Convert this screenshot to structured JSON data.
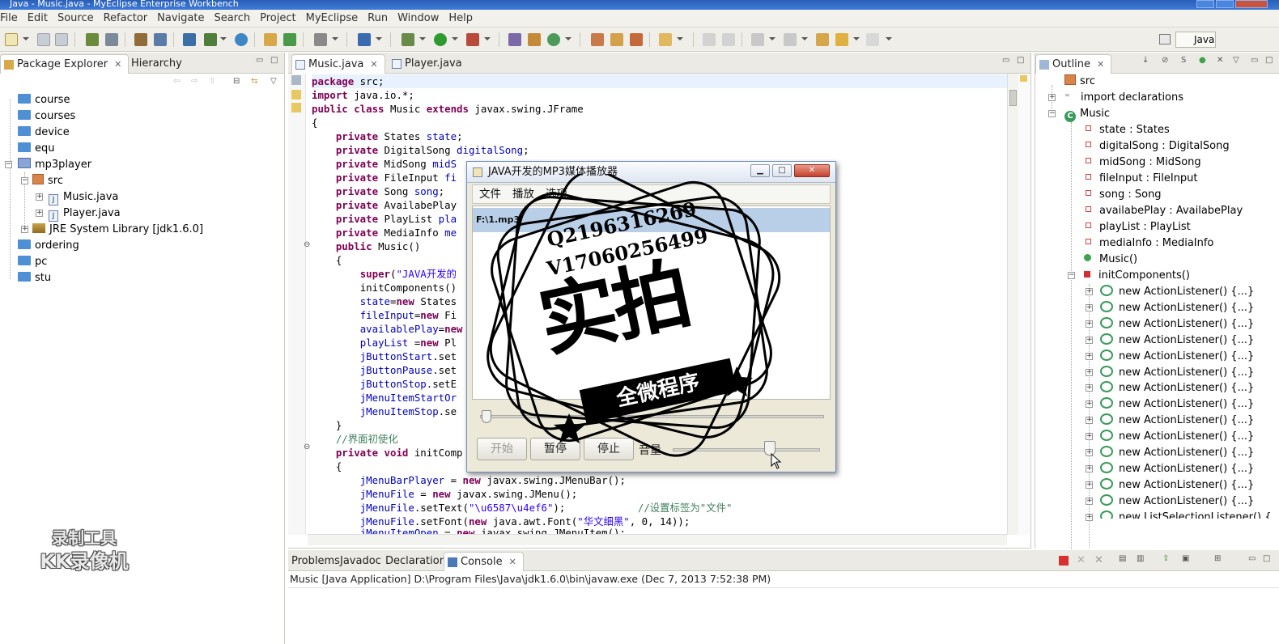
{
  "window": {
    "title": "Java - Music.java - MyEclipse Enterprise Workbench"
  },
  "menu": [
    "File",
    "Edit",
    "Source",
    "Refactor",
    "Navigate",
    "Search",
    "Project",
    "MyEclipse",
    "Run",
    "Window",
    "Help"
  ],
  "perspective": {
    "label": "Java"
  },
  "package_explorer": {
    "tabs": [
      {
        "label": "Package Explorer"
      },
      {
        "label": "Hierarchy"
      }
    ],
    "tree": {
      "course": "course",
      "courses": "courses",
      "device": "device",
      "equ": "equ",
      "mp3player": "mp3player",
      "src": "src",
      "music_java": "Music.java",
      "player_java": "Player.java",
      "jre": "JRE System Library [jdk1.6.0]",
      "ordering": "ordering",
      "pc": "pc",
      "stu": "stu"
    }
  },
  "editor": {
    "tabs": [
      {
        "label": "Music.java"
      },
      {
        "label": "Player.java"
      }
    ],
    "code": {
      "l1a": "package",
      "l1b": " src;",
      "l2a": "import",
      "l2b": " java.io.*;",
      "l3a": "public class",
      "l3b": " Music ",
      "l3c": "extends",
      "l3d": " javax.swing.JFrame",
      "l4": "{",
      "private": "private",
      "f1t": " States ",
      "f1n": "state",
      "f1e": ";",
      "f2t": " DigitalSong ",
      "f2n": "digitalSong",
      "f2e": ";",
      "f3t": " MidSong ",
      "f3n": "midS",
      "f4t": " FileInput ",
      "f4n": "fi",
      "f5t": " Song ",
      "f5n": "song",
      "f5e": ";",
      "f6t": " AvailabePlay",
      "f7t": " PlayList ",
      "f7n": "pla",
      "f8t": " MediaInfo ",
      "f8n": "me",
      "ctor_a": "public",
      "ctor_b": " Music()",
      "ob": "{",
      "c1a": "super",
      "c1b": "(",
      "c1c": "\"JAVA开发的",
      "c2": "initComponents()",
      "c3a": "state",
      "c3b": "=",
      "c3c": "new",
      "c3d": " States",
      "c4a": "fileInput",
      "c4b": "=",
      "c4c": "new",
      "c4d": " Fi",
      "c5a": "availablePlay",
      "c5b": "=",
      "c5c": "new",
      "c6a": "playList",
      "c6b": " =",
      "c6c": "new",
      "c6d": " Pl",
      "c7a": "jButtonStart",
      "c7b": ".set",
      "c8a": "jButtonPause",
      "c8b": ".set",
      "c9a": "jButtonStop",
      "c9b": ".setE",
      "c10a": "jMenuItemStartOr",
      "c11a": "jMenuItemStop",
      "c11b": ".se",
      "cb": "}",
      "cmt1": "//界面初使化",
      "m1a": "private void",
      "m1b": " initComp",
      "ob2": "{",
      "m2a": "jMenuBarPlayer",
      "m2b": " = ",
      "m2c": "new",
      "m2d": " javax.swing.JMenuBar();",
      "m3a": "jMenuFile",
      "m3b": " = ",
      "m3c": "new",
      "m3d": " javax.swing.JMenu();",
      "m4a": "jMenuFile",
      "m4b": ".setText(",
      "m4c": "\"\\u6587\\u4ef6\"",
      "m4d": ");",
      "m4e": "//设置标签为\"文件\"",
      "m5a": "jMenuFile",
      "m5b": ".setFont(",
      "m5c": "new",
      "m5d": " java.awt.Font(",
      "m5e": "\"华文细黑\"",
      "m5f": ", 0, 14));",
      "m6a": "jMenuItemOpen",
      "m6b": " = ",
      "m6c": "new",
      "m6d": " javax.swing.JMenuItem();"
    }
  },
  "outline": {
    "tab": "Outline",
    "items": {
      "src": "src",
      "imports": "import declarations",
      "music": "Music",
      "f1": "state : States",
      "f2": "digitalSong : DigitalSong",
      "f3": "midSong : MidSong",
      "f4": "fileInput : FileInput",
      "f5": "song : Song",
      "f6": "availabePlay : AvailabePlay",
      "f7": "playList : PlayList",
      "f8": "mediaInfo : MediaInfo",
      "ctor": "Music()",
      "init": "initComponents()",
      "anon": "new ActionListener() {...}",
      "anon_last": "new ListSelectionListener() {...}"
    }
  },
  "console": {
    "tabs": [
      {
        "label": "Problems"
      },
      {
        "label": "Javadoc"
      },
      {
        "label": "Declaration"
      },
      {
        "label": "Console"
      }
    ],
    "status": "Music [Java Application] D:\\Program Files\\Java\\jdk1.6.0\\bin\\javaw.exe (Dec 7, 2013 7:52:38 PM)"
  },
  "player": {
    "title": "JAVA开发的MP3媒体播放器",
    "menu": [
      "文件",
      "播放",
      "选项"
    ],
    "playlist": [
      "F:\\1.mp3"
    ],
    "progress": 0.0,
    "buttons": {
      "start": "开始",
      "pause": "暂停",
      "stop": "停止"
    },
    "volume_label": "音量",
    "volume": 0.66
  },
  "watermark": {
    "line1": "Q2196316269",
    "line2": "V17060256499",
    "big": "实拍",
    "banner": "全微程序"
  },
  "recorder_watermark": {
    "line1": "录制工具",
    "line2": "KK录像机"
  }
}
